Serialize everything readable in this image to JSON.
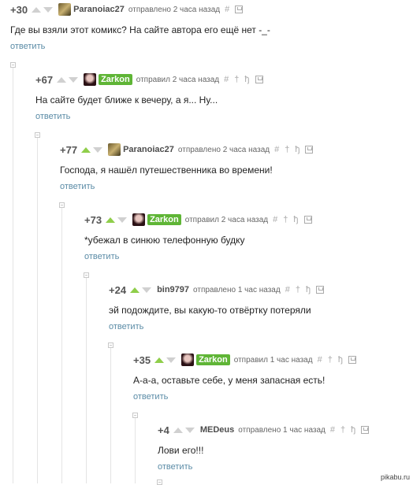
{
  "comments": [
    {
      "rating": "+30",
      "up_active": false,
      "user": "Paranoiac27",
      "avatar": "paranoiac-avatar",
      "meta": "отправлено 2 часа назад",
      "extra_icons": false,
      "text": "Где вы взяли этот комикс? На сайте автора его ещё нет -_-",
      "reply": "ответить"
    },
    {
      "rating": "+67",
      "up_active": false,
      "user": "Zarkon",
      "avatar": "zarkon-avatar",
      "meta": "отправил 2 часа назад",
      "extra_icons": true,
      "text": "На сайте будет ближе к вечеру, а я... Ну...",
      "reply": "ответить"
    },
    {
      "rating": "+77",
      "up_active": true,
      "user": "Paranoiac27",
      "avatar": "paranoiac-avatar",
      "meta": "отправлено 2 часа назад",
      "extra_icons": true,
      "text": "Господа, я нашёл путешественника во времени!",
      "reply": "ответить"
    },
    {
      "rating": "+73",
      "up_active": true,
      "user": "Zarkon",
      "avatar": "zarkon-avatar",
      "meta": "отправил 2 часа назад",
      "extra_icons": true,
      "text": "*убежал в синюю телефонную будку",
      "reply": "ответить"
    },
    {
      "rating": "+24",
      "up_active": true,
      "user": "bin9797",
      "avatar": "",
      "meta": "отправлено 1 час назад",
      "extra_icons": true,
      "text": "эй подождите, вы какую-то отвёртку потеряли",
      "reply": "ответить"
    },
    {
      "rating": "+35",
      "up_active": true,
      "user": "Zarkon",
      "avatar": "zarkon-avatar",
      "meta": "отправил 1 час назад",
      "extra_icons": true,
      "text": "А-а-а, оставьте себе, у меня запасная есть!",
      "reply": "ответить"
    },
    {
      "rating": "+4",
      "up_active": false,
      "user": "MEDeus",
      "avatar": "",
      "meta": "отправлено 1 час назад",
      "extra_icons": true,
      "text": "Лови его!!!",
      "reply": "ответить"
    }
  ],
  "icons": {
    "hash": "#",
    "dagger": "†",
    "fork": "ђ"
  },
  "colors": {
    "accent_green": "#5fb536",
    "vote_green": "#8fce4a",
    "link": "#5a8ba6"
  },
  "watermark": "pikabu.ru"
}
